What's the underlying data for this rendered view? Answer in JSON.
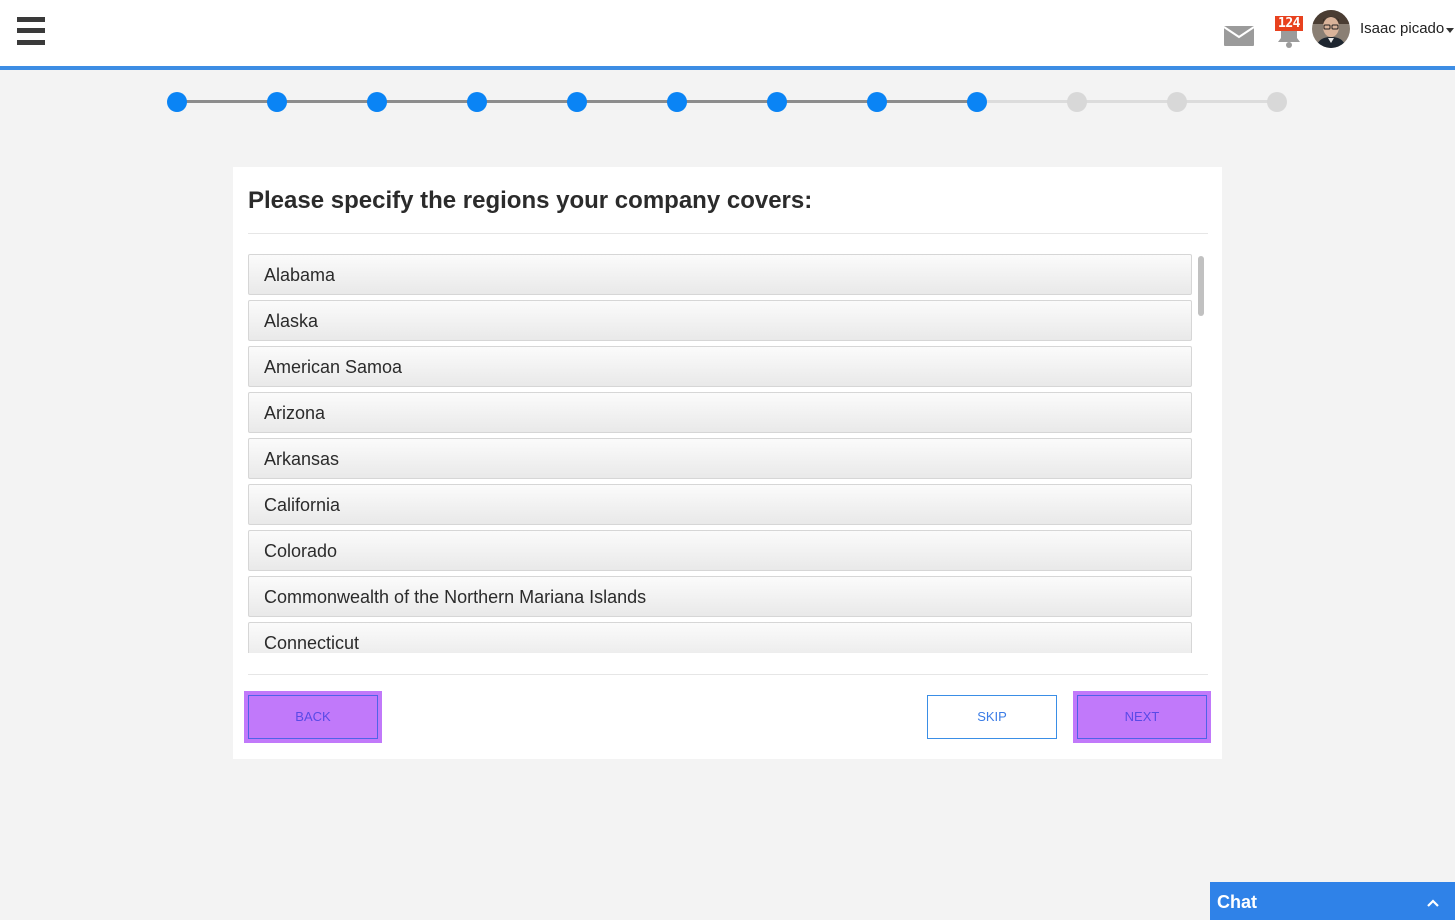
{
  "header": {
    "username": "Isaac picado",
    "notification_count": "124"
  },
  "stepper": {
    "total_steps": 12,
    "completed_steps": 9,
    "active_color": "#0a84f5",
    "inactive_color": "#d8d8d8"
  },
  "card": {
    "title": "Please specify the regions your company covers:",
    "regions": [
      "Alabama",
      "Alaska",
      "American Samoa",
      "Arizona",
      "Arkansas",
      "California",
      "Colorado",
      "Commonwealth of the Northern Mariana Islands",
      "Connecticut"
    ]
  },
  "buttons": {
    "back": "BACK",
    "skip": "SKIP",
    "next": "NEXT"
  },
  "chat": {
    "label": "Chat"
  },
  "colors": {
    "accent": "#3d8de4",
    "highlight": "#c179fa",
    "badge": "#e8411e"
  }
}
